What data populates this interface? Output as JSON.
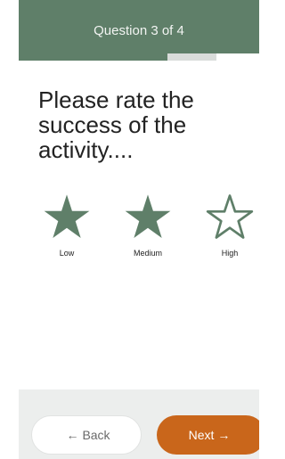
{
  "header": {
    "title": "Question 3 of 4"
  },
  "progress": {
    "current": 3,
    "total": 4,
    "fraction": 0.75
  },
  "question": {
    "text": "Please rate the success of the activity...."
  },
  "rating": {
    "selected_value": 2,
    "options": [
      {
        "label": "Low",
        "filled": true,
        "icon": "star-filled-icon"
      },
      {
        "label": "Medium",
        "filled": true,
        "icon": "star-filled-icon"
      },
      {
        "label": "High",
        "filled": false,
        "icon": "star-outline-icon"
      }
    ]
  },
  "navigation": {
    "back_label": "Back",
    "back_icon": "arrow-left-icon",
    "next_label": "Next",
    "next_icon": "arrow-right-icon"
  },
  "colors": {
    "header_bg": "#5f7f69",
    "star_fill": "#5f7f69",
    "next_button": "#c9661b",
    "footer_bg": "#eceeed"
  }
}
